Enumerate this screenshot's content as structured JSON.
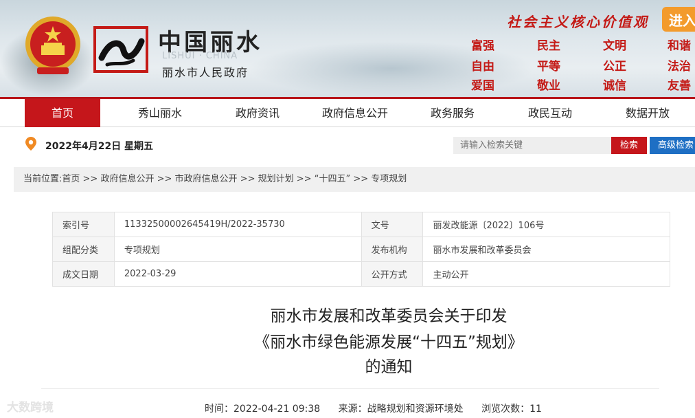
{
  "header": {
    "site_name_cn": "中国丽水",
    "site_name_en": "LISHUI · CHINA",
    "site_sub": "丽水市人民政府",
    "slogan": "社会主义核心价值观",
    "enter_label": "进入",
    "values": [
      "富强",
      "民主",
      "文明",
      "和谐",
      "自由",
      "平等",
      "公正",
      "法治",
      "爱国",
      "敬业",
      "诚信",
      "友善"
    ]
  },
  "nav": {
    "items": [
      "首页",
      "秀山丽水",
      "政府资讯",
      "政府信息公开",
      "政务服务",
      "政民互动",
      "数据开放"
    ],
    "active": "首页"
  },
  "date_bar": {
    "date": "2022年4月22日 星期五",
    "search_placeholder": "请输入检索关键",
    "search_label": "检索",
    "advanced_label": "高级检索"
  },
  "breadcrumb": {
    "prefix": "当前位置:",
    "items": [
      "首页",
      "政府信息公开",
      "市政府信息公开",
      "规划计划",
      "“十四五”",
      "专项规划"
    ],
    "separator": " >> "
  },
  "meta": {
    "index_label": "索引号",
    "index_value": "11332500002645419H/2022-35730",
    "docno_label": "文号",
    "docno_value": "丽发改能源〔2022〕106号",
    "category_label": "组配分类",
    "category_value": "专项规划",
    "org_label": "发布机构",
    "org_value": "丽水市发展和改革委员会",
    "date_label": "成文日期",
    "date_value": "2022-03-29",
    "mode_label": "公开方式",
    "mode_value": "主动公开"
  },
  "article": {
    "title_line1": "丽水市发展和改革委员会关于印发",
    "title_line2": "《丽水市绿色能源发展“十四五”规划》",
    "title_line3": "的通知",
    "time": "时间：2022-04-21 09:38",
    "source": "来源：战略规划和资源环境处",
    "views": "浏览次数：11"
  },
  "watermark": "大数跨境",
  "colors": {
    "brand_red": "#c5161b",
    "advanced_blue": "#1e6fc4",
    "enter_orange": "#f39b2c"
  }
}
